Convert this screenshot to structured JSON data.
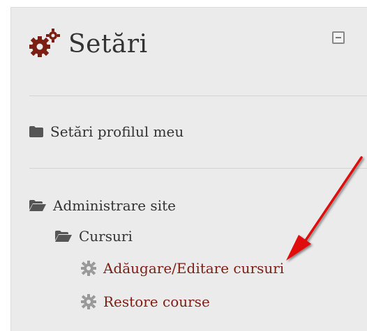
{
  "block": {
    "title": "Setări",
    "icon": "gears-icon",
    "collapse_icon": "minus-square-icon"
  },
  "nav": {
    "profile_settings": "Setări profilul meu",
    "site_admin": "Administrare site",
    "courses": "Cursuri",
    "add_edit_courses": "Adăugare/Editare cursuri",
    "restore_course": "Restore course"
  },
  "colors": {
    "accent": "#7a1f12",
    "annotation_arrow": "#e01010",
    "panel_bg": "#ebebeb"
  }
}
